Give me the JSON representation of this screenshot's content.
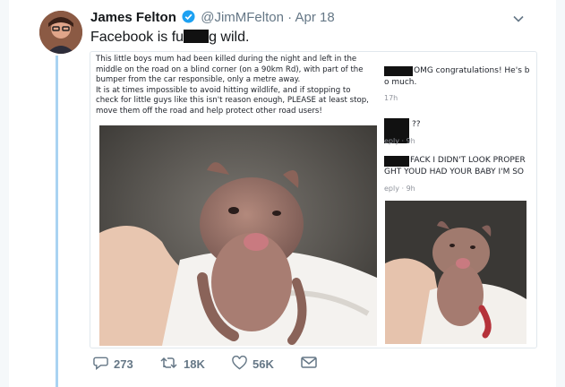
{
  "tweet": {
    "author_name": "James Felton",
    "handle": "@JimMFelton",
    "separator": "·",
    "date": "Apr 18",
    "text_before": "Facebook is fu",
    "text_after": "g wild."
  },
  "post": {
    "paragraph1": "This little boys mum had been killed during the night and left in the middle on the road on a blind corner (on a 90km Rd), with part of the bumper from the car responsible, only a metre away.",
    "paragraph2": "It is at times impossible to avoid hitting wildlife, and if stopping to check for little guys like this isn't reason enough, PLEASE at least stop, move them off the road and help protect other road users!"
  },
  "comments": [
    {
      "text": "OMG congratulations! He's b",
      "text2": "o much.",
      "meta": "17h"
    },
    {
      "text": "??",
      "meta": "eply · 9h"
    },
    {
      "text": "FACK I DIDN'T LOOK PROPER",
      "text2": "GHT YOUD HAD YOUR BABY I'M SO",
      "meta": "eply · 9h"
    }
  ],
  "actions": {
    "replies": "273",
    "retweets": "18K",
    "likes": "56K"
  },
  "icons": [
    "verified-badge-icon",
    "chevron-down-icon",
    "reply-icon",
    "retweet-icon",
    "like-icon",
    "message-icon"
  ],
  "colors": {
    "accent": "#1da1f2",
    "thread_line": "#a9d3f2",
    "muted": "#657786"
  }
}
